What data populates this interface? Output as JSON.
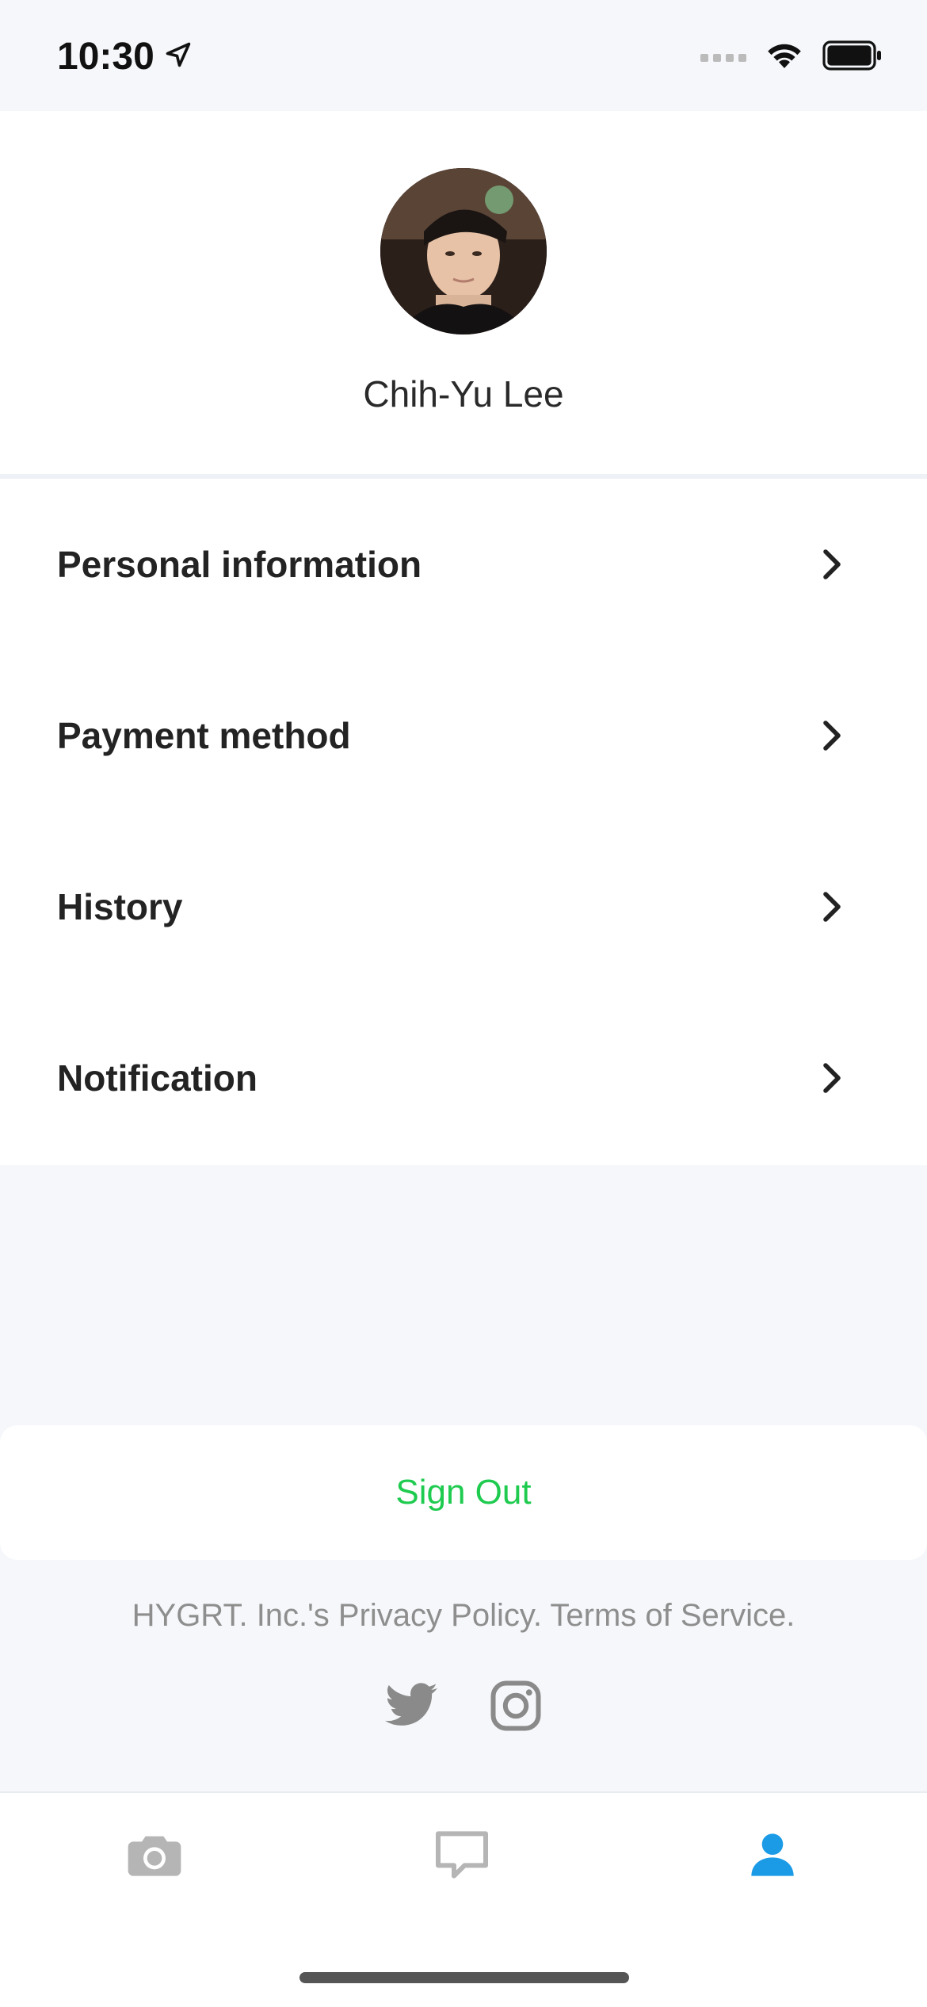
{
  "status_bar": {
    "time": "10:30",
    "icons": [
      "location-arrow-icon",
      "signal-icon",
      "wifi-icon",
      "battery-icon"
    ]
  },
  "profile": {
    "name": "Chih-Yu Lee"
  },
  "menu": {
    "items": [
      {
        "label": "Personal information"
      },
      {
        "label": "Payment method"
      },
      {
        "label": "History"
      },
      {
        "label": "Notification"
      }
    ]
  },
  "signout": {
    "label": "Sign Out",
    "color": "#1ecb4f"
  },
  "footer": {
    "legal_text": "HYGRT. Inc.'s Privacy Policy. Terms of Service.",
    "social_icons": [
      "twitter-icon",
      "instagram-icon"
    ]
  },
  "tabbar": {
    "tabs": [
      "camera-icon",
      "chat-icon",
      "profile-icon"
    ],
    "active": "profile-icon",
    "active_color": "#1b9be6",
    "inactive_color": "#b5b5b5"
  }
}
